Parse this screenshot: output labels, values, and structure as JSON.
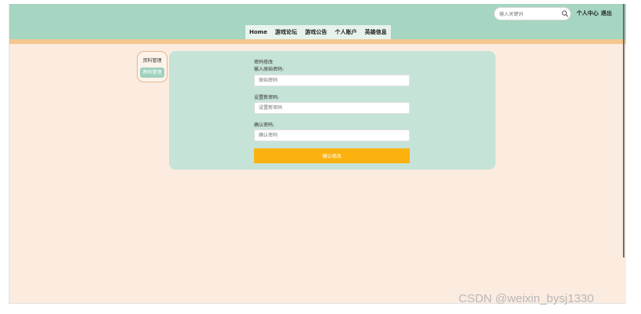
{
  "header": {
    "search": {
      "placeholder": "输入关键词",
      "icon": "search-icon"
    },
    "links": {
      "personal_center": "个人中心",
      "logout": "退出"
    },
    "colors": {
      "header_bg": "#a6d5c2",
      "stripe": "#f3c78f"
    }
  },
  "nav": {
    "items": [
      {
        "label": "Home"
      },
      {
        "label": "游戏论坛"
      },
      {
        "label": "游戏公告"
      },
      {
        "label": "个人账户"
      },
      {
        "label": "英雄信息"
      }
    ],
    "active_index": 0
  },
  "sidebar": {
    "items": [
      {
        "label": "资料管理"
      },
      {
        "label": "密码管理"
      }
    ],
    "active_index": 1
  },
  "form": {
    "title": "密码修改",
    "old_password": {
      "label": "输入原始密码:",
      "placeholder": "原始密码"
    },
    "new_password": {
      "label": "设置新密码:",
      "placeholder": "设置新密码"
    },
    "confirm_password": {
      "label": "确认密码:",
      "placeholder": "确认密码"
    },
    "submit_label": "确认修改",
    "colors": {
      "panel_bg": "#c6e3d7",
      "submit_bg": "#fbb20e"
    }
  },
  "watermark": "CSDN @weixin_bysj1330"
}
